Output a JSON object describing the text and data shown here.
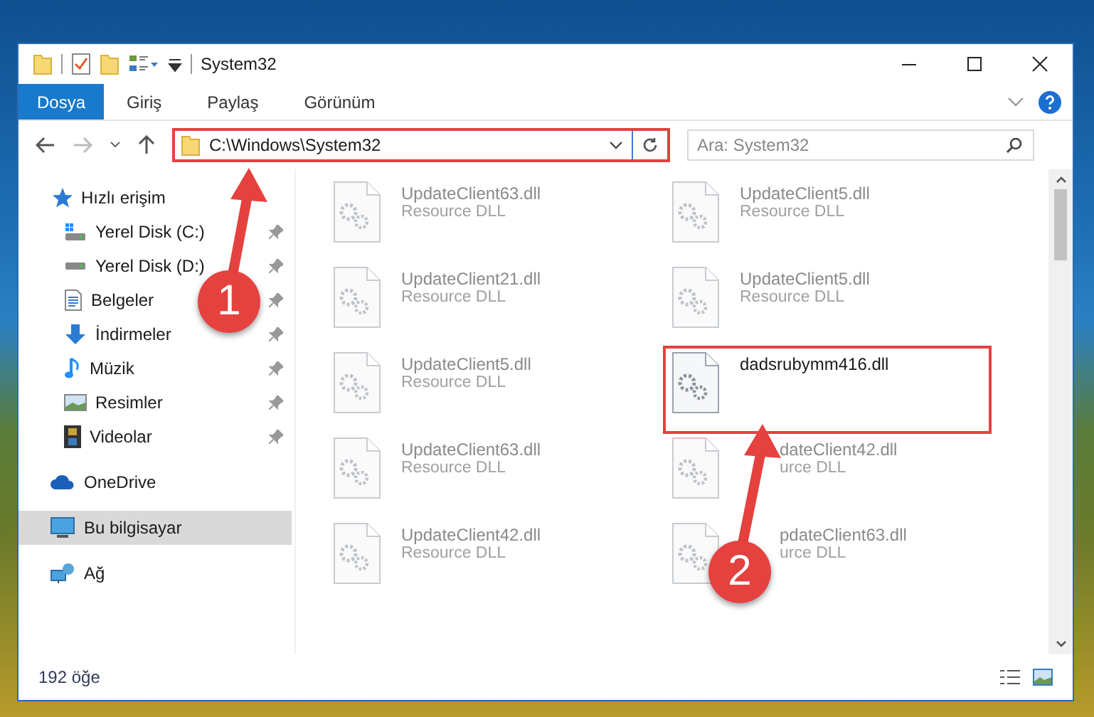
{
  "window": {
    "title": "System32"
  },
  "ribbon_tabs": [
    {
      "label": "Dosya",
      "selected": true
    },
    {
      "label": "Giriş",
      "selected": false
    },
    {
      "label": "Paylaş",
      "selected": false
    },
    {
      "label": "Görünüm",
      "selected": false
    }
  ],
  "address_bar": {
    "value": "C:\\Windows\\System32",
    "highlighted": true
  },
  "search": {
    "placeholder": "Ara: System32"
  },
  "sidebar": {
    "items": [
      {
        "label": "Hızlı erişim",
        "kind": "star",
        "selected": false,
        "children": [
          {
            "label": "Yerel Disk (C:)",
            "kind": "disk-c",
            "pinned": true,
            "selected": false
          },
          {
            "label": "Yerel Disk (D:)",
            "kind": "disk",
            "pinned": true,
            "selected": false
          },
          {
            "label": "Belgeler",
            "kind": "documents",
            "pinned": true,
            "selected": false
          },
          {
            "label": "İndirmeler",
            "kind": "downloads",
            "pinned": true,
            "selected": false
          },
          {
            "label": "Müzik",
            "kind": "music",
            "pinned": true,
            "selected": false
          },
          {
            "label": "Resimler",
            "kind": "pictures",
            "pinned": true,
            "selected": false
          },
          {
            "label": "Videolar",
            "kind": "videos",
            "pinned": true,
            "selected": false
          }
        ]
      },
      {
        "label": "OneDrive",
        "kind": "cloud",
        "selected": false
      },
      {
        "label": "Bu bilgisayar",
        "kind": "computer",
        "selected": true
      },
      {
        "label": "Ağ",
        "kind": "network",
        "selected": false
      }
    ]
  },
  "files": [
    {
      "name": "UpdateClient63.dll",
      "type": "Resource DLL",
      "blurred": true,
      "highlighted": false
    },
    {
      "name": "UpdateClient5.dll",
      "type": "Resource DLL",
      "blurred": true,
      "highlighted": false
    },
    {
      "name": "UpdateClient21.dll",
      "type": "Resource DLL",
      "blurred": true,
      "highlighted": false
    },
    {
      "name": "UpdateClient5.dll",
      "type": "Resource DLL",
      "blurred": true,
      "highlighted": false
    },
    {
      "name": "UpdateClient5.dll",
      "type": "Resource DLL",
      "blurred": true,
      "highlighted": false
    },
    {
      "name": "dadsrubymm416.dll",
      "blurred": false,
      "highlighted": true
    },
    {
      "name": "UpdateClient63.dll",
      "type": "Resource DLL",
      "blurred": true,
      "highlighted": false
    },
    {
      "name": "dateClient42.dll",
      "type": "urce DLL",
      "blurred": true,
      "highlighted": false,
      "covered": true
    },
    {
      "name": "UpdateClient42.dll",
      "type": "Resource DLL",
      "blurred": true,
      "highlighted": false
    },
    {
      "name": "pdateClient63.dll",
      "type": "urce DLL",
      "blurred": true,
      "highlighted": false,
      "covered": true
    }
  ],
  "status_bar": {
    "item_count": "192 öğe"
  },
  "annotations": [
    {
      "label": "1"
    },
    {
      "label": "2"
    }
  ]
}
